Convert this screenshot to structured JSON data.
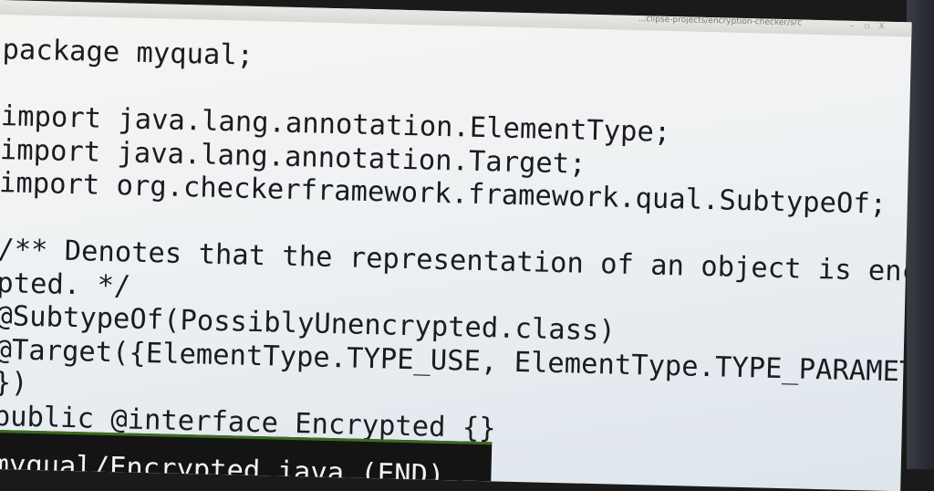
{
  "window": {
    "title": "...clipse-projects/encryption-checker/src",
    "controls": [
      "–",
      "▫",
      "X"
    ]
  },
  "editor": {
    "lines": [
      "package myqual;",
      "",
      "import java.lang.annotation.ElementType;",
      "import java.lang.annotation.Target;",
      "import org.checkerframework.framework.qual.SubtypeOf;",
      "",
      "/** Denotes that the representation of an object is encry",
      "pted. */",
      "@SubtypeOf(PossiblyUnencrypted.class)",
      "@Target({ElementType.TYPE_USE, ElementType.TYPE_PARAMETER",
      "})",
      "public @interface Encrypted {}"
    ]
  },
  "status_bar": {
    "text": "myqual/Encrypted.java (END)"
  }
}
